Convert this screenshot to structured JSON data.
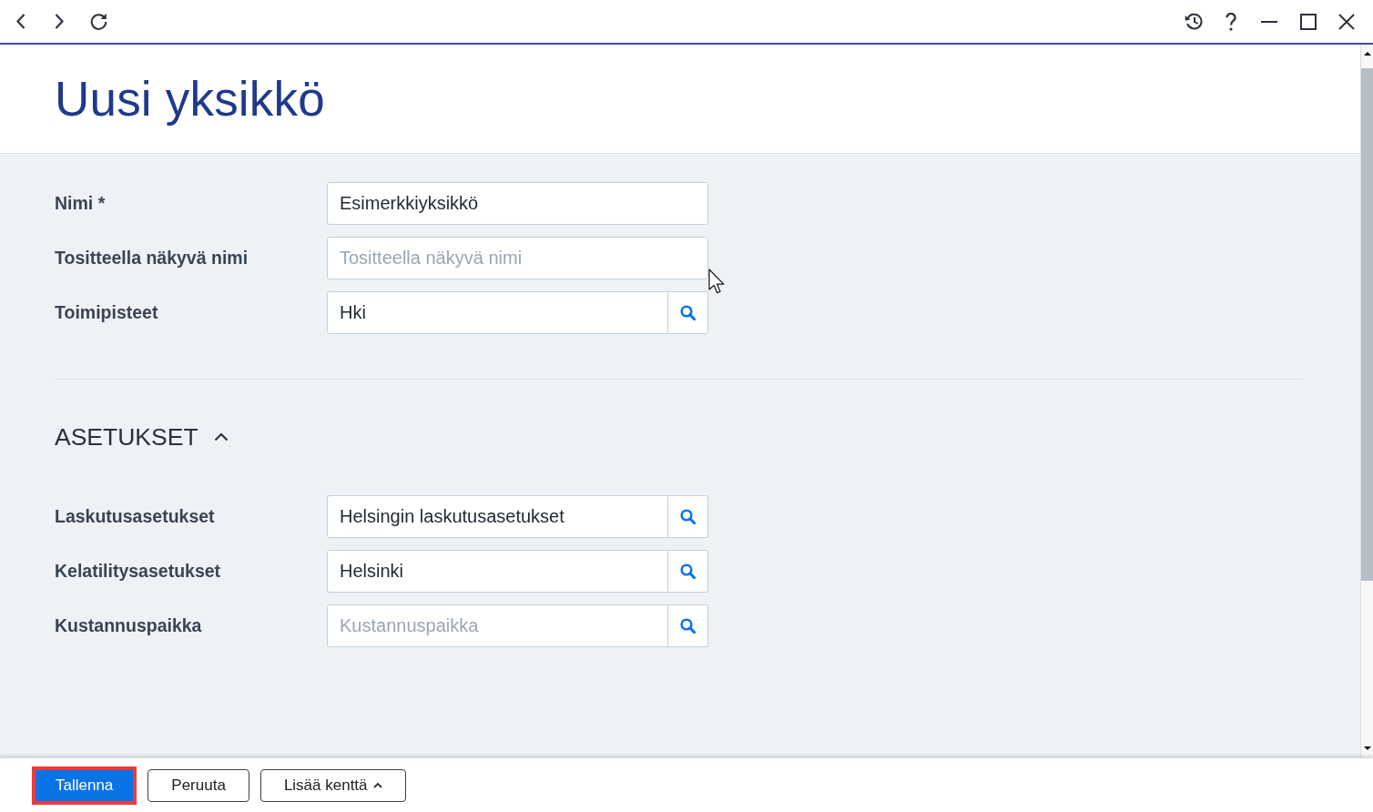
{
  "page": {
    "title": "Uusi yksikkö"
  },
  "fields": [
    {
      "label": "Nimi *",
      "kind": "text",
      "value": "Esimerkkiyksikkö"
    },
    {
      "label": "Tositteella näkyvä nimi",
      "kind": "text",
      "placeholder": "Tositteella näkyvä nimi"
    },
    {
      "label": "Toimipisteet",
      "kind": "lookup",
      "value": "Hki"
    }
  ],
  "sections": [
    {
      "title": "ASETUKSET",
      "expanded": true,
      "fields": [
        {
          "label": "Laskutusasetukset",
          "kind": "lookup",
          "value": "Helsingin laskutusasetukset"
        },
        {
          "label": "Kelatilitysasetukset",
          "kind": "lookup",
          "value": "Helsinki"
        },
        {
          "label": "Kustannuspaikka",
          "kind": "lookup",
          "placeholder": "Kustannuspaikka"
        }
      ]
    }
  ],
  "footer_buttons": [
    {
      "label": "Tallenna",
      "kind": "primary",
      "focused": true
    },
    {
      "label": "Peruuta",
      "kind": "secondary",
      "focused": false
    },
    {
      "label": "Lisää kenttä",
      "kind": "menu",
      "focused": false
    }
  ]
}
